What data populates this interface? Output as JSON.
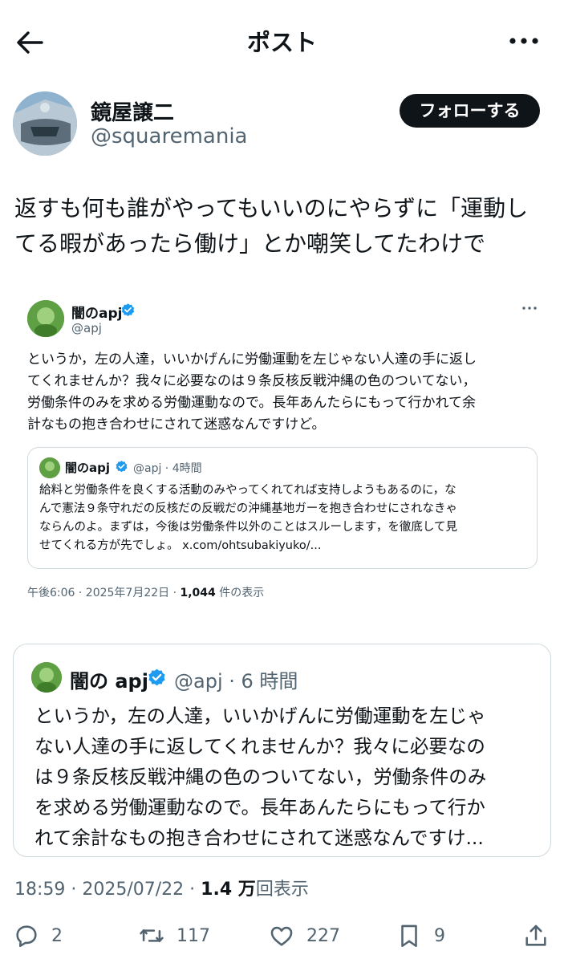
{
  "header": {
    "title": "ポスト"
  },
  "author": {
    "name": "鏡屋譲二",
    "handle": "@squaremania",
    "follow_label": "フォローする"
  },
  "post": {
    "text_line1": "返すも何も誰がやってもいいのにやらずに「運動し",
    "text_line2": "てる暇があったら働け」とか嘲笑してたわけで"
  },
  "screenshot": {
    "name": "闇のapj",
    "handle": "@apj",
    "text_lines": [
      "というか，左の人達，いいかげんに労働運動を左じゃない人達の手に返し",
      "てくれませんか？我々に必要なのは９条反核反戦沖縄の色のついてない，",
      "労働条件のみを求める労働運動なので。長年あんたらにもって行かれて余",
      "計なもの抱き合わせにされて迷惑なんですけど。"
    ],
    "quote": {
      "name": "闇のapj",
      "handle_time": "@apj · 4時間",
      "text_lines": [
        "給料と労働条件を良くする活動のみやってくれてれば支持しようもあるのに，な",
        "んで憲法９条守れだの反核だの反戦だの沖縄基地ガーを抱き合わせにされなきゃ",
        "ならんのよ。まずは，今後は労働条件以外のことはスルーします，を徹底して見",
        "せてくれる方が先でしょ。 x.com/ohtsubakiyuko/..."
      ]
    },
    "meta_prefix": "午後6:06 · 2025年7月22日 · ",
    "meta_views": "1,044",
    "meta_suffix": " 件の表示"
  },
  "quoted": {
    "name": "闇の apj",
    "handle_time": "@apj · 6 時間",
    "text_lines": [
      "というか，左の人達，いいかげんに労働運動を左じゃ",
      "ない人達の手に返してくれませんか？我々に必要なの",
      "は９条反核反戦沖縄の色のついてない，労働条件のみ",
      "を求める労働運動なので。長年あんたらにもって行か",
      "れて余計なもの抱き合わせにされて迷惑なんですけ..."
    ]
  },
  "meta": {
    "time_date": "18:59 · 2025/07/22 · ",
    "views": "1.4 万",
    "views_label": "回表示"
  },
  "actions": {
    "replies": "2",
    "reposts": "117",
    "likes": "227",
    "bookmarks": "9"
  },
  "colors": {
    "text": "#0f1419",
    "secondary": "#536471",
    "border": "#cfd9de",
    "verified": "#1d9bf0"
  },
  "icons": [
    "back-arrow-icon",
    "more-icon",
    "verified-icon",
    "reply-icon",
    "repost-icon",
    "like-icon",
    "bookmark-icon",
    "share-icon"
  ]
}
